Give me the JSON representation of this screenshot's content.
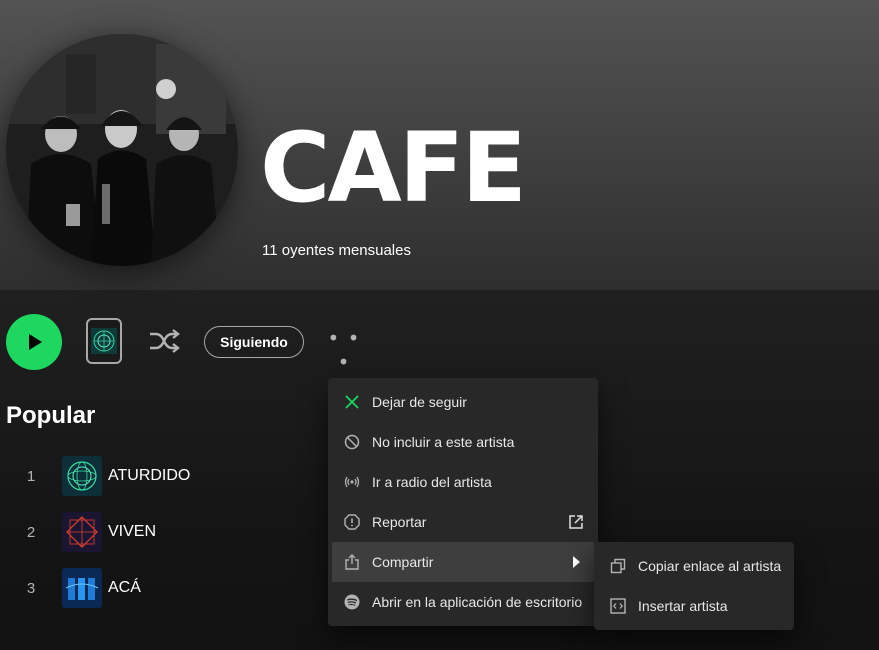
{
  "artist": {
    "name": "CAFE",
    "monthly_listeners": "11 oyentes mensuales"
  },
  "controls": {
    "follow_label": "Siguiendo",
    "more_label": "• • •"
  },
  "popular": {
    "title": "Popular",
    "tracks": [
      {
        "number": "1",
        "title": "ATURDIDO"
      },
      {
        "number": "2",
        "title": "VIVEN"
      },
      {
        "number": "3",
        "title": "ACÁ"
      }
    ]
  },
  "context_menu": {
    "items": [
      {
        "label": "Dejar de seguir",
        "icon": "x-icon"
      },
      {
        "label": "No incluir a este artista",
        "icon": "block-icon"
      },
      {
        "label": "Ir a radio del artista",
        "icon": "radio-icon"
      },
      {
        "label": "Reportar",
        "icon": "report-icon"
      },
      {
        "label": "Compartir",
        "icon": "share-icon"
      },
      {
        "label": "Abrir en la aplicación de escritorio",
        "icon": "spotify-icon"
      }
    ],
    "submenu": [
      {
        "label": "Copiar enlace al artista",
        "icon": "copy-icon"
      },
      {
        "label": "Insertar artista",
        "icon": "embed-icon"
      }
    ]
  },
  "colors": {
    "accent_green": "#1ed760",
    "background": "#121212",
    "menu_bg": "#282828",
    "menu_hover": "#3e3e3e"
  }
}
